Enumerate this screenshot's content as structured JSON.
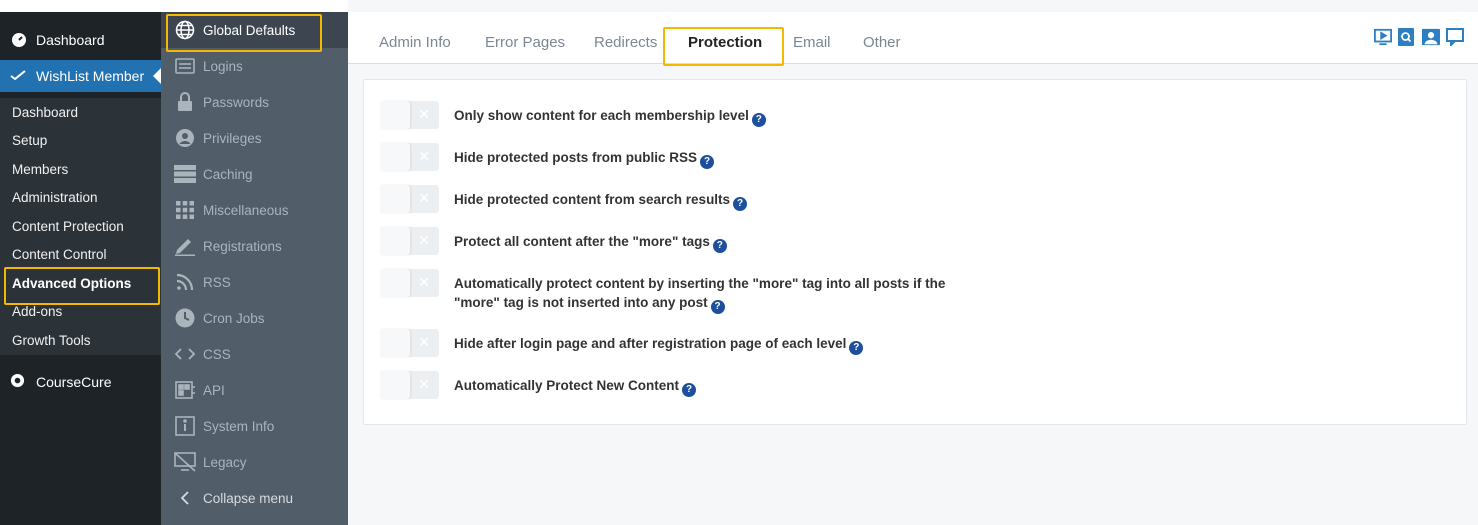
{
  "wp_sidebar": {
    "dashboard": "Dashboard",
    "wishlist": "WishList Member",
    "sub_items": [
      "Dashboard",
      "Setup",
      "Members",
      "Administration",
      "Content Protection",
      "Content Control",
      "Advanced Options",
      "Add-ons",
      "Growth Tools"
    ],
    "coursecure": "CourseCure"
  },
  "wl_sidebar": {
    "items": [
      "Global Defaults",
      "Logins",
      "Passwords",
      "Privileges",
      "Caching",
      "Miscellaneous",
      "Registrations",
      "RSS",
      "Cron Jobs",
      "CSS",
      "API",
      "System Info",
      "Legacy"
    ],
    "collapse": "Collapse menu"
  },
  "tabs": [
    "Admin Info",
    "Error Pages",
    "Redirects",
    "Protection",
    "Email",
    "Other"
  ],
  "settings": [
    "Only show content for each membership level",
    "Hide protected posts from public RSS",
    "Hide protected content from search results",
    "Protect all content after the \"more\" tags",
    "Automatically protect content by inserting the \"more\" tag into all posts if the \"more\" tag is not inserted into any post",
    "Hide after login page and after registration page of each level",
    "Automatically Protect New Content"
  ],
  "colors": {
    "accent": "#2271b1",
    "highlight": "#f5b800",
    "help": "#1d4f9c"
  }
}
